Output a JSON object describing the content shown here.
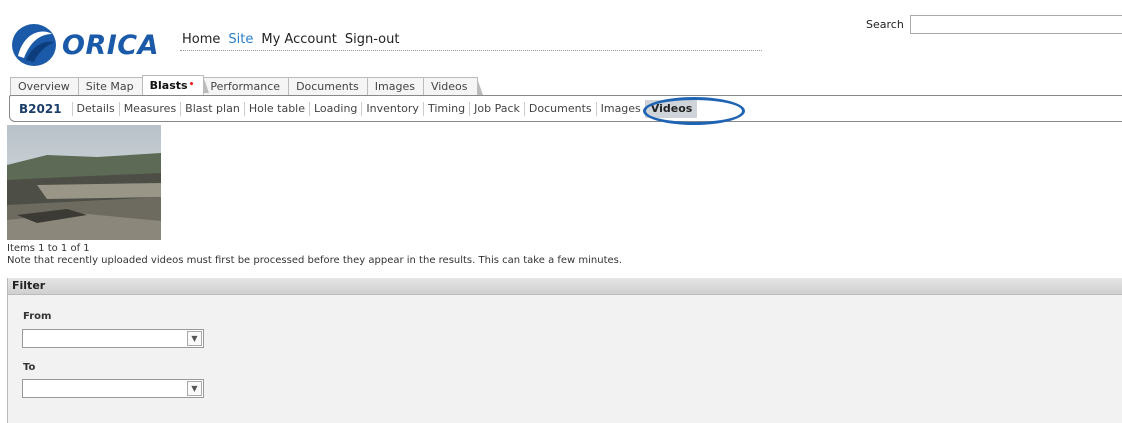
{
  "header": {
    "logo_text": "ORICA",
    "nav": [
      "Home",
      "Site",
      "My Account",
      "Sign-out"
    ],
    "active_nav": "Site",
    "search_label": "Search",
    "search_value": ""
  },
  "tabs": [
    {
      "label": "Overview"
    },
    {
      "label": "Site Map"
    },
    {
      "label": "Blasts",
      "active": true,
      "badge": "•"
    },
    {
      "label": "Performance"
    },
    {
      "label": "Documents"
    },
    {
      "label": "Images"
    },
    {
      "label": "Videos"
    }
  ],
  "subbar": {
    "blast_id": "B2021",
    "items": [
      "Details",
      "Measures",
      "Blast plan",
      "Hole table",
      "Loading",
      "Inventory",
      "Timing",
      "Job Pack",
      "Documents",
      "Images",
      "Videos"
    ],
    "selected": "Videos"
  },
  "results": {
    "count_text": "Items 1 to 1 of 1",
    "note": "Note that recently uploaded videos must first be processed before they appear in the results. This can take a few minutes."
  },
  "filter": {
    "title": "Filter",
    "from_label": "From",
    "to_label": "To",
    "from_value": "",
    "to_value": ""
  },
  "colors": {
    "brand": "#1b5aa8",
    "highlight_ring": "#1f63b3",
    "active_nav": "#2a7fc9"
  }
}
